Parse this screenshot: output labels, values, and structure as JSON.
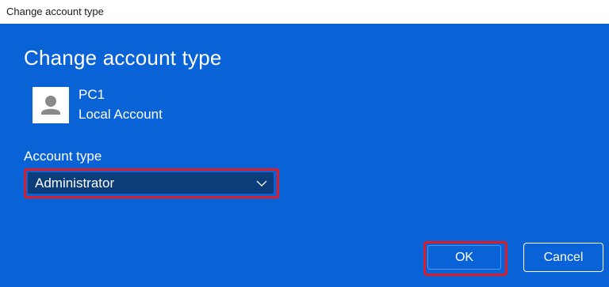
{
  "window": {
    "title": "Change account type"
  },
  "dialog": {
    "heading": "Change account type",
    "account": {
      "name": "PC1",
      "kind": "Local Account",
      "avatar_icon": "user-avatar-icon"
    },
    "account_type": {
      "label": "Account type",
      "selected_value": "Administrator",
      "dropdown_icon": "chevron-down-icon"
    },
    "buttons": {
      "ok_label": "OK",
      "cancel_label": "Cancel"
    }
  },
  "colors": {
    "dialog_background": "#0a63d6",
    "select_background": "#0a3d7a",
    "highlight_outline": "#e01b24",
    "text": "#ffffff"
  }
}
